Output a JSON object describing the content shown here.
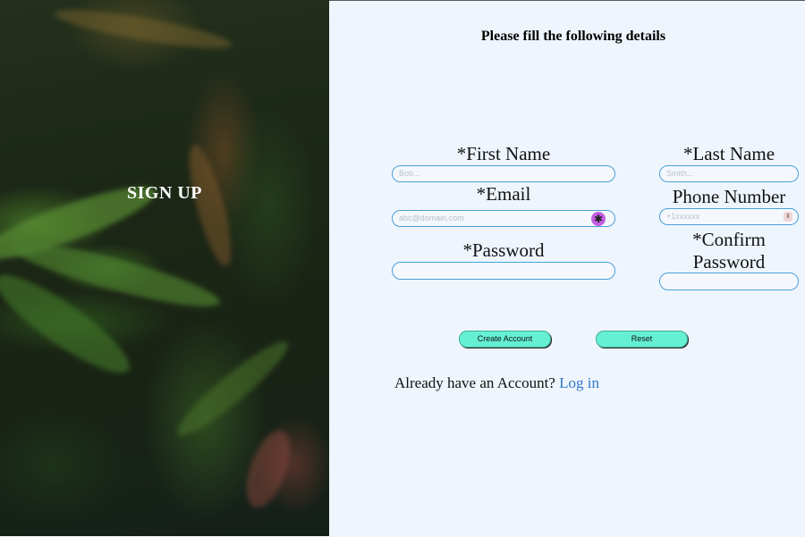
{
  "left_panel": {
    "title": "SIGN UP"
  },
  "form": {
    "heading": "Please fill the following details",
    "first_name": {
      "label": "*First Name",
      "placeholder": "Bob..."
    },
    "last_name": {
      "label": "*Last Name",
      "placeholder": "Smith..."
    },
    "email": {
      "label": "*Email",
      "placeholder": "abc@domain.com"
    },
    "phone": {
      "label": "Phone Number",
      "placeholder": "+1xxxxxx"
    },
    "password": {
      "label": "*Password",
      "placeholder": ""
    },
    "confirm_password": {
      "label_line1": "*Confirm",
      "label_line2": "Password",
      "placeholder": ""
    },
    "buttons": {
      "create": "Create Account",
      "reset": "Reset"
    },
    "account_prompt": "Already have an Account?",
    "login_link": "Log in"
  },
  "colors": {
    "form_background": "#eef5fd",
    "input_border": "#4b9fd8",
    "button_fill": "#66f0d3",
    "link": "#2e77c8"
  },
  "icons": {
    "password_manager": "key-icon",
    "phone_spinner": "spinner-icon"
  }
}
